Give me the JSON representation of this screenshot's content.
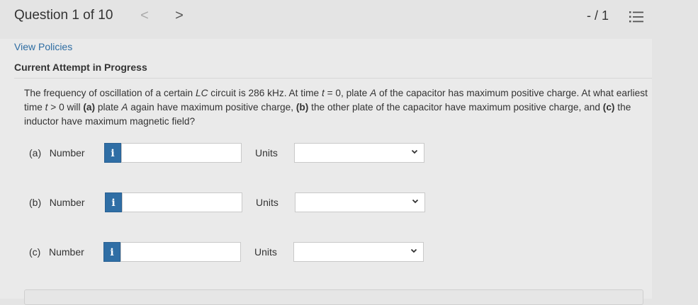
{
  "header": {
    "question_label": "Question 1 of 10",
    "prev_glyph": "<",
    "next_glyph": ">",
    "score": "- / 1",
    "list_icon": "list-icon"
  },
  "links": {
    "view_policies": "View Policies"
  },
  "status": {
    "attempt": "Current Attempt in Progress"
  },
  "question": {
    "parts": [
      {
        "t": "The frequency of oscillation of a certain "
      },
      {
        "t": "LC",
        "i": true
      },
      {
        "t": " circuit is 286 kHz. At time "
      },
      {
        "t": "t",
        "i": true
      },
      {
        "t": " = 0, plate "
      },
      {
        "t": "A",
        "i": true
      },
      {
        "t": " of the capacitor has maximum positive charge. At what earliest time "
      },
      {
        "t": "t",
        "i": true
      },
      {
        "t": " > 0 will "
      },
      {
        "t": "(a)",
        "b": true
      },
      {
        "t": " plate "
      },
      {
        "t": "A",
        "i": true
      },
      {
        "t": " again have maximum positive charge, "
      },
      {
        "t": "(b)",
        "b": true
      },
      {
        "t": " the other plate of the capacitor have maximum positive charge, and "
      },
      {
        "t": "(c)",
        "b": true
      },
      {
        "t": " the inductor have maximum magnetic field?"
      }
    ]
  },
  "answers": [
    {
      "label": "(a)   Number",
      "info": "i",
      "value": "",
      "units_label": "Units",
      "units_value": ""
    },
    {
      "label": "(b)   Number",
      "info": "i",
      "value": "",
      "units_label": "Units",
      "units_value": ""
    },
    {
      "label": "(c)   Number",
      "info": "i",
      "value": "",
      "units_label": "Units",
      "units_value": ""
    }
  ]
}
